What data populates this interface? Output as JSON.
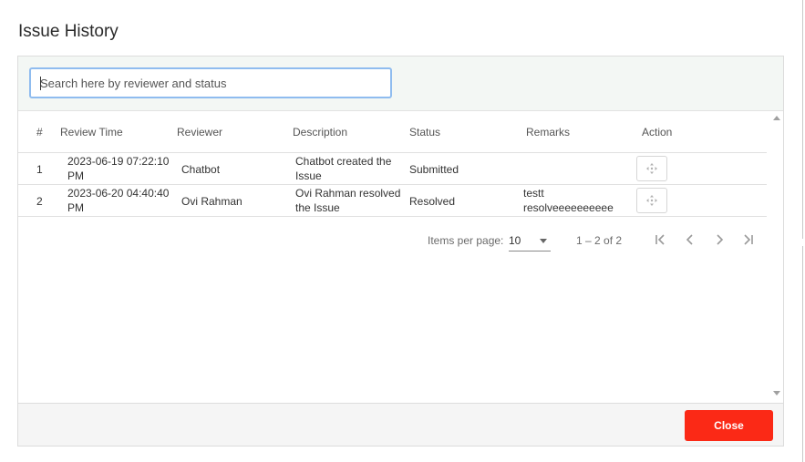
{
  "dialog": {
    "title": "Issue History",
    "close_label": "Close"
  },
  "search": {
    "placeholder": "Search here by reviewer and status",
    "value": ""
  },
  "table": {
    "columns": [
      "#",
      "Review Time",
      "Reviewer",
      "Description",
      "Status",
      "Remarks",
      "Action"
    ],
    "rows": [
      {
        "index": "1",
        "time_line1": "2023-06-19 07:22:10",
        "time_line2": "PM",
        "reviewer": "Chatbot",
        "desc_line1": "Chatbot created the",
        "desc_line2": "Issue",
        "status": "Submitted",
        "remarks_line1": "",
        "remarks_line2": ""
      },
      {
        "index": "2",
        "time_line1": "2023-06-20 04:40:40",
        "time_line2": "PM",
        "reviewer": "Ovi Rahman",
        "desc_line1": "Ovi Rahman resolved",
        "desc_line2": "the Issue",
        "status": "Resolved",
        "remarks_line1": "testt",
        "remarks_line2": "resolveeeeeeeeee"
      }
    ],
    "action_icon": "move-icon"
  },
  "paginator": {
    "items_per_page_label": "Items per page:",
    "page_size": "10",
    "range_label": "1 – 2 of 2"
  },
  "colors": {
    "close_button": "#fb2916",
    "search_focus_border": "#8fbcef",
    "search_bar_bg": "#f3f7f4"
  }
}
